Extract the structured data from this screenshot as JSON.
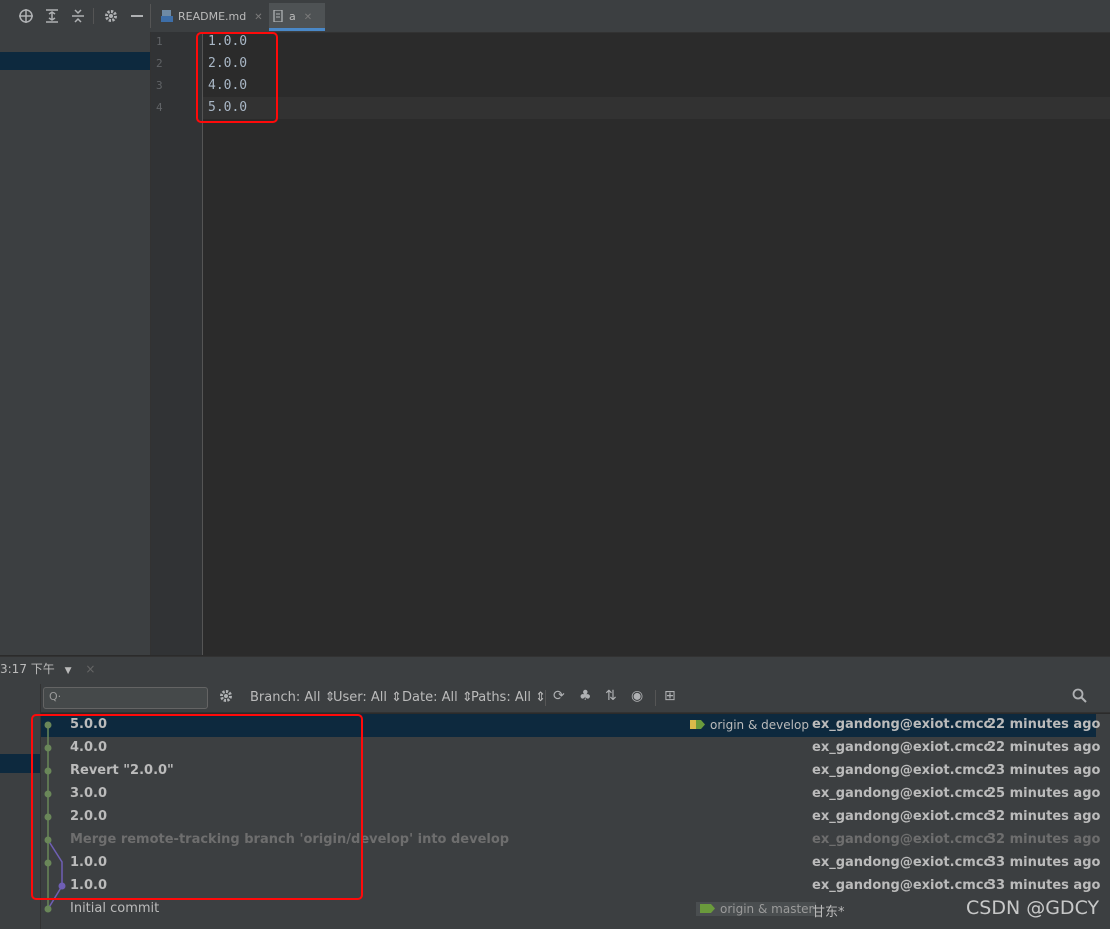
{
  "toolbar": {
    "icons": [
      "target-icon",
      "expand-all-icon",
      "collapse-all-icon",
      "gear-icon",
      "minimize-icon"
    ]
  },
  "tabs": [
    {
      "label": "README.md",
      "icon": "markdown-file-icon",
      "active": false
    },
    {
      "label": "a",
      "icon": "text-file-icon",
      "active": true
    }
  ],
  "editor": {
    "lines": [
      {
        "num": "1",
        "text": "1.0.0"
      },
      {
        "num": "2",
        "text": "2.0.0"
      },
      {
        "num": "3",
        "text": "4.0.0"
      },
      {
        "num": "4",
        "text": "5.0.0"
      }
    ]
  },
  "bottom": {
    "title": "3:17 下午",
    "close": "×"
  },
  "vcs": {
    "search_placeholder": "Q·",
    "filters": {
      "branch": "Branch: All",
      "user": "User: All",
      "date": "Date: All",
      "paths": "Paths: All"
    },
    "commits": [
      {
        "message": "5.0.0",
        "refs": "origin & develop",
        "author": "ex_gandong@exiot.cmcc",
        "time": "22 minutes ago",
        "selected": true,
        "dim": false
      },
      {
        "message": "4.0.0",
        "refs": "",
        "author": "ex_gandong@exiot.cmcc",
        "time": "22 minutes ago",
        "selected": false,
        "dim": false
      },
      {
        "message": "Revert \"2.0.0\"",
        "refs": "",
        "author": "ex_gandong@exiot.cmcc",
        "time": "23 minutes ago",
        "selected": false,
        "dim": false
      },
      {
        "message": "3.0.0",
        "refs": "",
        "author": "ex_gandong@exiot.cmcc",
        "time": "25 minutes ago",
        "selected": false,
        "dim": false
      },
      {
        "message": "2.0.0",
        "refs": "",
        "author": "ex_gandong@exiot.cmcc",
        "time": "32 minutes ago",
        "selected": false,
        "dim": false
      },
      {
        "message": "Merge remote-tracking branch 'origin/develop' into develop",
        "refs": "",
        "author": "ex_gandong@exiot.cmcc",
        "time": "32 minutes ago",
        "selected": false,
        "dim": true
      },
      {
        "message": "1.0.0",
        "refs": "",
        "author": "ex_gandong@exiot.cmcc",
        "time": "33 minutes ago",
        "selected": false,
        "dim": false
      },
      {
        "message": "1.0.0",
        "refs": "",
        "author": "ex_gandong@exiot.cmcc",
        "time": "33 minutes ago",
        "selected": false,
        "dim": false
      },
      {
        "message": "Initial commit",
        "refs": "origin & master",
        "author": "甘东*",
        "time": "",
        "selected": false,
        "dim": false
      }
    ]
  },
  "watermark": "CSDN @GDCY",
  "colors": {
    "background": "#2b2b2b",
    "panel": "#3c3f41",
    "selection": "#0d293e",
    "graph_green": "#6a8759",
    "graph_purple": "#6f5fb5",
    "highlight_red": "#ff0a0a"
  }
}
